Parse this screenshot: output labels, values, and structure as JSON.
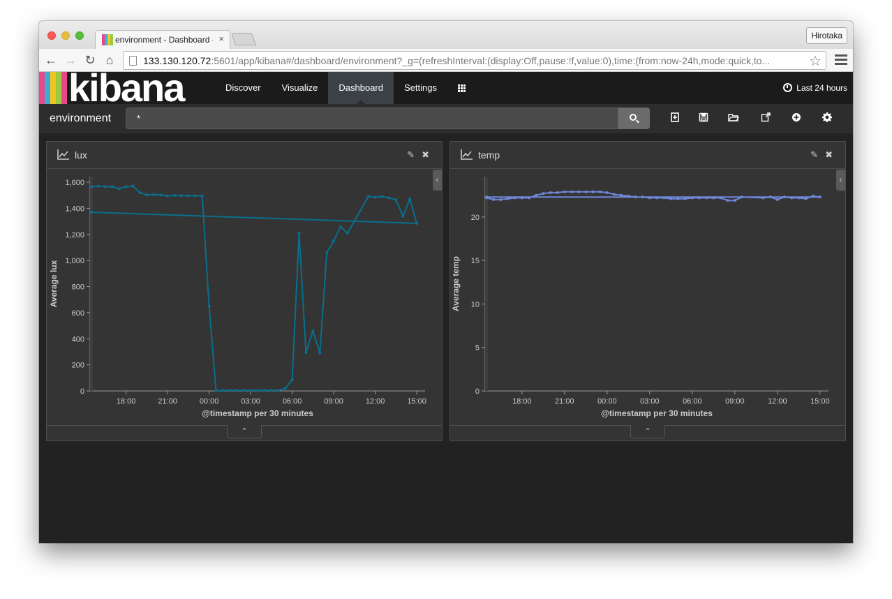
{
  "browser": {
    "tab_title": "environment - Dashboard - ",
    "tab_close": "×",
    "profile": "Hirotaka",
    "url_host": "133.130.120.72",
    "url_rest": ":5601/app/kibana#/dashboard/environment?_g=(refreshInterval:(display:Off,pause:!f,value:0),time:(from:now-24h,mode:quick,to..."
  },
  "kibana": {
    "nav": [
      "Discover",
      "Visualize",
      "Dashboard",
      "Settings"
    ],
    "active": "Dashboard",
    "time_range": "Last 24 hours",
    "logo_colors": [
      "#e8478b",
      "#3caed2",
      "#f2c61f",
      "#9aca3f",
      "#e8478b"
    ],
    "logo_text": "kibana"
  },
  "dashboard": {
    "title": "environment",
    "query": "*",
    "actions": [
      "new-dashboard-icon",
      "save-icon",
      "open-icon",
      "share-icon",
      "add-visualization-icon",
      "settings-icon"
    ]
  },
  "panels": [
    {
      "title": "lux"
    },
    {
      "title": "temp"
    }
  ],
  "chart_data": [
    {
      "type": "line",
      "title": "lux",
      "xlabel": "@timestamp per 30 minutes",
      "ylabel": "Average lux",
      "color": "#0a6e8c",
      "x_ticks": [
        "18:00",
        "21:00",
        "00:00",
        "03:00",
        "06:00",
        "09:00",
        "12:00",
        "15:00"
      ],
      "y_ticks": [
        "0",
        "200",
        "400",
        "600",
        "800",
        "1,000",
        "1,200",
        "1,400",
        "1,600"
      ],
      "ylim": [
        0,
        1600
      ],
      "x": [
        "15:30",
        "16:00",
        "16:30",
        "17:00",
        "17:30",
        "18:00",
        "18:30",
        "19:00",
        "19:30",
        "20:00",
        "20:30",
        "21:00",
        "21:30",
        "22:00",
        "22:30",
        "23:00",
        "23:30",
        "00:00",
        "00:30",
        "01:00",
        "01:30",
        "02:00",
        "02:30",
        "03:00",
        "03:30",
        "04:00",
        "04:30",
        "05:00",
        "05:30",
        "06:00",
        "06:30",
        "07:00",
        "07:30",
        "08:00",
        "08:30",
        "09:00",
        "09:30",
        "10:00",
        "10:30",
        "11:00",
        "11:30",
        "12:00",
        "12:30",
        "13:00",
        "13:30",
        "14:00",
        "14:30",
        "15:00",
        "15:30"
      ],
      "values": [
        1565,
        1570,
        1565,
        1566,
        1550,
        1565,
        1570,
        1520,
        1503,
        1505,
        1502,
        1495,
        1498,
        1497,
        1496,
        1496,
        1496,
        650,
        5,
        5,
        5,
        5,
        5,
        5,
        5,
        5,
        5,
        5,
        20,
        85,
        1210,
        295,
        460,
        290,
        1060,
        1150,
        1260,
        1210,
        null,
        null,
        1490,
        1485,
        1490,
        1480,
        1465,
        1340,
        1470,
        1285,
        1370
      ]
    },
    {
      "type": "line",
      "title": "temp",
      "xlabel": "@timestamp per 30 minutes",
      "ylabel": "Average temp",
      "color": "#6f87d8",
      "x_ticks": [
        "18:00",
        "21:00",
        "00:00",
        "03:00",
        "06:00",
        "09:00",
        "12:00",
        "15:00"
      ],
      "y_ticks": [
        "0",
        "5",
        "10",
        "15",
        "20"
      ],
      "ylim": [
        0,
        24
      ],
      "x": [
        "15:30",
        "16:00",
        "16:30",
        "17:00",
        "17:30",
        "18:00",
        "18:30",
        "19:00",
        "19:30",
        "20:00",
        "20:30",
        "21:00",
        "21:30",
        "22:00",
        "22:30",
        "23:00",
        "23:30",
        "00:00",
        "00:30",
        "01:00",
        "01:30",
        "02:00",
        "02:30",
        "03:00",
        "03:30",
        "04:00",
        "04:30",
        "05:00",
        "05:30",
        "06:00",
        "06:30",
        "07:00",
        "07:30",
        "08:00",
        "08:30",
        "09:00",
        "09:30",
        "10:00",
        "10:30",
        "11:00",
        "11:30",
        "12:00",
        "12:30",
        "13:00",
        "13:30",
        "14:00",
        "14:30",
        "15:00",
        "15:30"
      ],
      "values": [
        22.2,
        22.0,
        22.0,
        22.1,
        22.2,
        22.2,
        22.2,
        22.5,
        22.7,
        22.8,
        22.8,
        22.9,
        22.9,
        22.9,
        22.9,
        22.9,
        22.9,
        22.8,
        22.6,
        22.5,
        22.4,
        22.3,
        22.3,
        22.2,
        22.2,
        22.2,
        22.1,
        22.1,
        22.1,
        22.2,
        22.2,
        22.2,
        22.2,
        22.2,
        21.9,
        21.9,
        22.3,
        null,
        null,
        22.2,
        22.3,
        22.0,
        22.3,
        22.2,
        22.2,
        22.1,
        22.4,
        22.3,
        22.3
      ]
    }
  ]
}
